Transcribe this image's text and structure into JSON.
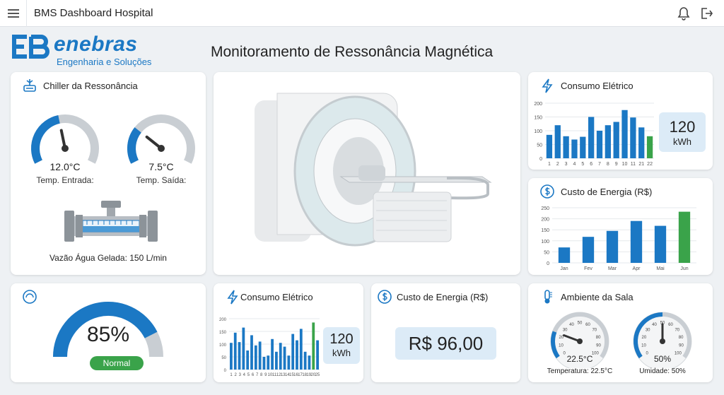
{
  "header": {
    "app_title": "BMS Dashboard Hospital"
  },
  "logo": {
    "word": "enebras",
    "subtitle": "Engenharia e Soluções",
    "mark": "EB"
  },
  "page": {
    "title": "Monitoramento de Ressonância Magnética"
  },
  "chiller": {
    "title": "Chiller da Ressonância",
    "inlet_value": "12.0°C",
    "inlet_label": "Temp. Entrada:",
    "inlet_level": 0.45,
    "outlet_value": "7.5°C",
    "outlet_label": "Temp. Saída:",
    "outlet_level": 0.28,
    "flow_label": "Vazão Água Gelada: 150 L/min"
  },
  "consumo_top": {
    "title": "Consumo Elétrico",
    "value": "120",
    "unit": "kWh"
  },
  "custo_top": {
    "title": "Custo de Energia (R$)"
  },
  "efficiency": {
    "value": "85%",
    "status": "Normal",
    "level": 0.85
  },
  "consumo_bottom": {
    "title": "Consumo Elétrico",
    "value": "120",
    "unit": "kWh"
  },
  "custo_bottom": {
    "title": "Custo de Energia (R$)",
    "value": "R$ 96,00"
  },
  "ambiente": {
    "title": "Ambiente da Sala",
    "temp_value": "22.5°C",
    "temp_label": "Temperatura: 22.5°C",
    "temp_level": 0.225,
    "hum_value": "50%",
    "hum_label": "Umidade: 50%",
    "hum_level": 0.5,
    "dial_ticks": [
      "0",
      "10",
      "20",
      "30",
      "40",
      "50",
      "60",
      "70",
      "80",
      "90",
      "100"
    ]
  },
  "colors": {
    "blue": "#1b78c4",
    "green": "#3aa34a",
    "gauge_track": "#c9ced3"
  },
  "chart_data": [
    {
      "type": "bar",
      "title": "Consumo Elétrico",
      "categories": [
        "1",
        "2",
        "3",
        "4",
        "5",
        "6",
        "7",
        "8",
        "9",
        "10",
        "11",
        "21",
        "22"
      ],
      "values": [
        85,
        120,
        80,
        68,
        78,
        150,
        100,
        120,
        132,
        175,
        148,
        112,
        80
      ],
      "highlight_last": true,
      "ylim": [
        0,
        200
      ],
      "yticks": [
        "0",
        "50",
        "100",
        "150",
        "200"
      ],
      "xticks": [
        "1",
        "2",
        "3",
        "4",
        "5",
        "6",
        "7",
        "8",
        "9",
        "10",
        "11",
        "21",
        "22"
      ]
    },
    {
      "type": "bar",
      "title": "Custo de Energia (R$)",
      "categories": [
        "Jan",
        "Fev",
        "Mar",
        "Apr",
        "Mai",
        "Jun"
      ],
      "values": [
        70,
        118,
        145,
        190,
        168,
        232
      ],
      "highlight_last": true,
      "ylim": [
        0,
        250
      ],
      "yticks": [
        "0",
        "50",
        "100",
        "150",
        "200",
        "250"
      ],
      "xticks": [
        "Jan",
        "Fev",
        "Mar",
        "Apr",
        "Mai",
        "Jun"
      ]
    },
    {
      "type": "bar",
      "title": "Consumo Elétrico",
      "categories": [
        "1",
        "2",
        "3",
        "4",
        "5",
        "6",
        "7",
        "8",
        "9",
        "10",
        "11",
        "12",
        "13",
        "14",
        "15",
        "16",
        "17",
        "18",
        "19",
        "20",
        "25"
      ],
      "values": [
        105,
        145,
        108,
        165,
        75,
        135,
        95,
        110,
        50,
        55,
        120,
        70,
        105,
        90,
        55,
        140,
        115,
        160,
        70,
        55,
        185,
        115
      ],
      "highlight_index": 20,
      "ylim": [
        0,
        200
      ],
      "yticks": [
        "0",
        "50",
        "100",
        "150",
        "200"
      ],
      "xticks": [
        "1",
        "2",
        "3",
        "4",
        "5",
        "6",
        "7",
        "8",
        "9",
        "10",
        "11",
        "12",
        "13",
        "14",
        "15",
        "16",
        "17",
        "18",
        "19",
        "20",
        "25"
      ]
    }
  ]
}
